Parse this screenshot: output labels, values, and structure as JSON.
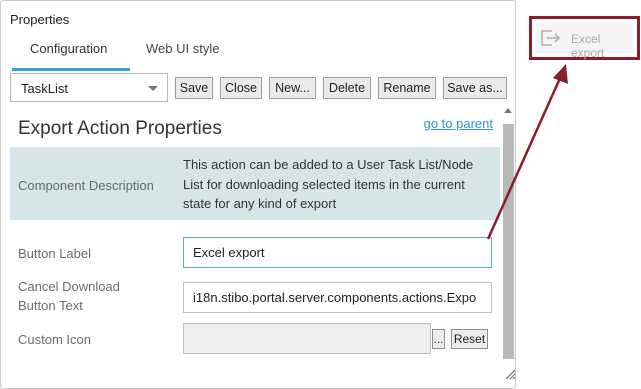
{
  "dialog": {
    "title": "Properties",
    "tabs": [
      {
        "label": "Configuration",
        "active": true
      },
      {
        "label": "Web UI style",
        "active": false
      }
    ]
  },
  "toolbar": {
    "selected_list": "TaskList",
    "buttons": {
      "save": "Save",
      "close": "Close",
      "new": "New...",
      "delete": "Delete",
      "rename": "Rename",
      "save_as": "Save as..."
    }
  },
  "content": {
    "heading": "Export Action Properties",
    "parent_link": "go to parent",
    "component_description": {
      "label": "Component Description",
      "text": "This action can be added to a User Task List/Node List for downloading selected items in the current state for any kind of export"
    },
    "button_label": {
      "label": "Button Label",
      "value": "Excel export"
    },
    "cancel_download": {
      "label_line1": "Cancel Download",
      "label_line2": "Button Text",
      "value": "i18n.stibo.portal.server.components.actions.Expo"
    },
    "custom_icon": {
      "label": "Custom Icon",
      "value": "",
      "browse": "...",
      "reset": "Reset"
    }
  },
  "preview": {
    "label": "Excel export",
    "icon": "export-icon"
  },
  "colors": {
    "accent": "#2fa4d0",
    "highlight_box": "#8a1d2c",
    "description_bg": "#d7e5e9"
  }
}
